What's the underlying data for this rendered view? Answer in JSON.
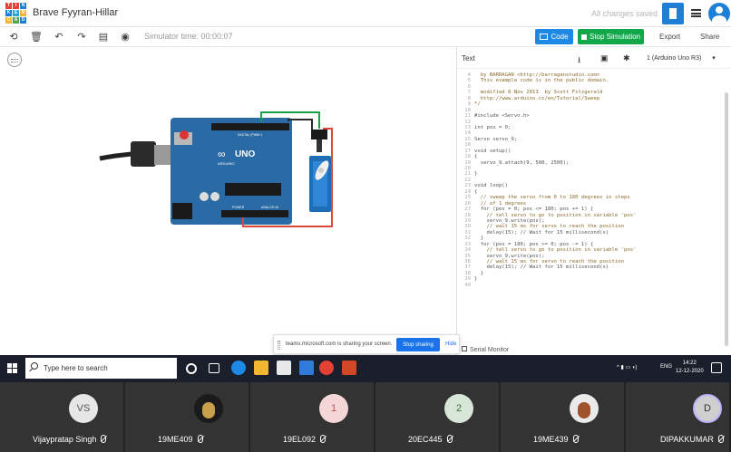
{
  "app": {
    "title": "Brave Fyyran-Hillar",
    "save_status": "All changes saved",
    "logo_letters": [
      "T",
      "I",
      "N",
      "K",
      "E",
      "R",
      "C",
      "A",
      "D"
    ],
    "brand_color": "#1e7fd6"
  },
  "toolbar": {
    "tools": [
      "rotate-icon",
      "delete-icon",
      "undo-icon",
      "redo-icon",
      "notes-icon",
      "visibility-icon"
    ],
    "sim_time": "Simulator time: 00:00:07",
    "code_label": "Code",
    "stop_label": "Stop Simulation",
    "export_label": "Export",
    "share_label": "Share"
  },
  "code_panel": {
    "mode": "Text",
    "board": "1 (Arduino Uno R3)",
    "serial_monitor": "Serial Monitor",
    "lines": [
      {
        "n": "4",
        "t": "  by BARRAGAN <http://barraganstudio.com>",
        "c": true
      },
      {
        "n": "5",
        "t": "  This example code is in the public domain.",
        "c": true
      },
      {
        "n": "6",
        "t": "",
        "c": false
      },
      {
        "n": "7",
        "t": "  modified 8 Nov 2013  by Scott Fitzgerald",
        "c": true
      },
      {
        "n": "8",
        "t": "  http://www.arduino.cc/en/Tutorial/Sweep",
        "c": true
      },
      {
        "n": "9",
        "t": "*/",
        "c": true
      },
      {
        "n": "10",
        "t": "",
        "c": false
      },
      {
        "n": "11",
        "t": "#include <Servo.h>",
        "c": false
      },
      {
        "n": "12",
        "t": "",
        "c": false
      },
      {
        "n": "13",
        "t": "int pos = 0;",
        "c": false
      },
      {
        "n": "14",
        "t": "",
        "c": false
      },
      {
        "n": "15",
        "t": "Servo servo_9;",
        "c": false
      },
      {
        "n": "16",
        "t": "",
        "c": false
      },
      {
        "n": "17",
        "t": "void setup()",
        "c": false
      },
      {
        "n": "18",
        "t": "{",
        "c": false
      },
      {
        "n": "19",
        "t": "  servo_9.attach(9, 500, 2500);",
        "c": false
      },
      {
        "n": "20",
        "t": "",
        "c": false
      },
      {
        "n": "21",
        "t": "}",
        "c": false
      },
      {
        "n": "22",
        "t": "",
        "c": false
      },
      {
        "n": "23",
        "t": "void loop()",
        "c": false
      },
      {
        "n": "24",
        "t": "{",
        "c": false
      },
      {
        "n": "25",
        "t": "  // sweep the servo from 0 to 180 degrees in steps",
        "c": true
      },
      {
        "n": "26",
        "t": "  // of 1 degrees",
        "c": true
      },
      {
        "n": "27",
        "t": "  for (pos = 0; pos <= 180; pos += 1) {",
        "c": false
      },
      {
        "n": "28",
        "t": "    // tell servo to go to position in variable 'pos'",
        "c": true
      },
      {
        "n": "29",
        "t": "    servo_9.write(pos);",
        "c": false
      },
      {
        "n": "30",
        "t": "    // wait 15 ms for servo to reach the position",
        "c": true
      },
      {
        "n": "31",
        "t": "    delay(15); // Wait for 15 millisecond(s)",
        "c": false
      },
      {
        "n": "32",
        "t": "  }",
        "c": false
      },
      {
        "n": "33",
        "t": "  for (pos = 180; pos >= 0; pos -= 1) {",
        "c": false
      },
      {
        "n": "34",
        "t": "    // tell servo to go to position in variable 'pos'",
        "c": true
      },
      {
        "n": "35",
        "t": "    servo_9.write(pos);",
        "c": false
      },
      {
        "n": "36",
        "t": "    // wait 15 ms for servo to reach the position",
        "c": true
      },
      {
        "n": "37",
        "t": "    delay(15); // Wait for 15 millisecond(s)",
        "c": false
      },
      {
        "n": "38",
        "t": "  }",
        "c": false
      },
      {
        "n": "39",
        "t": "}",
        "c": false
      },
      {
        "n": "40",
        "t": "",
        "c": false
      }
    ]
  },
  "board": {
    "uno_label": "UNO",
    "arduino_label": "ARDUINO",
    "digital_label": "DIGITAL (PWM~)",
    "power_label": "POWER",
    "analog_label": "ANALOG IN",
    "board_color": "#2a6aa5",
    "wire_colors": [
      "#2b2b2b",
      "#d94a3a",
      "#1a9e46"
    ]
  },
  "sharing": {
    "message": "teams.microsoft.com is sharing your screen.",
    "stop_label": "Stop sharing",
    "hide_label": "Hide"
  },
  "taskbar": {
    "search_placeholder": "Type here to search",
    "lang": "ENG",
    "time": "14:22",
    "date": "12-12-2020"
  },
  "participants": [
    {
      "name": "Vijaypratap Singh",
      "initials": "VS",
      "avatar_type": "initials",
      "color": "#e6e6e6",
      "text_color": "#555"
    },
    {
      "name": "19ME409",
      "initials": "",
      "avatar_type": "photo",
      "color": "#1b1b1b",
      "text_color": "#fff"
    },
    {
      "name": "19EL092",
      "initials": "1",
      "avatar_type": "initials",
      "color": "#f4d6d6",
      "text_color": "#b0505a"
    },
    {
      "name": "20EC445",
      "initials": "2",
      "avatar_type": "initials",
      "color": "#d7e6d7",
      "text_color": "#3a6b3a"
    },
    {
      "name": "19ME439",
      "initials": "",
      "avatar_type": "photo",
      "color": "#eaeaea",
      "text_color": "#fff"
    },
    {
      "name": "DIPAKKUMAR",
      "initials": "D",
      "avatar_type": "initials",
      "color": "#cfcfcf",
      "text_color": "#333"
    }
  ]
}
